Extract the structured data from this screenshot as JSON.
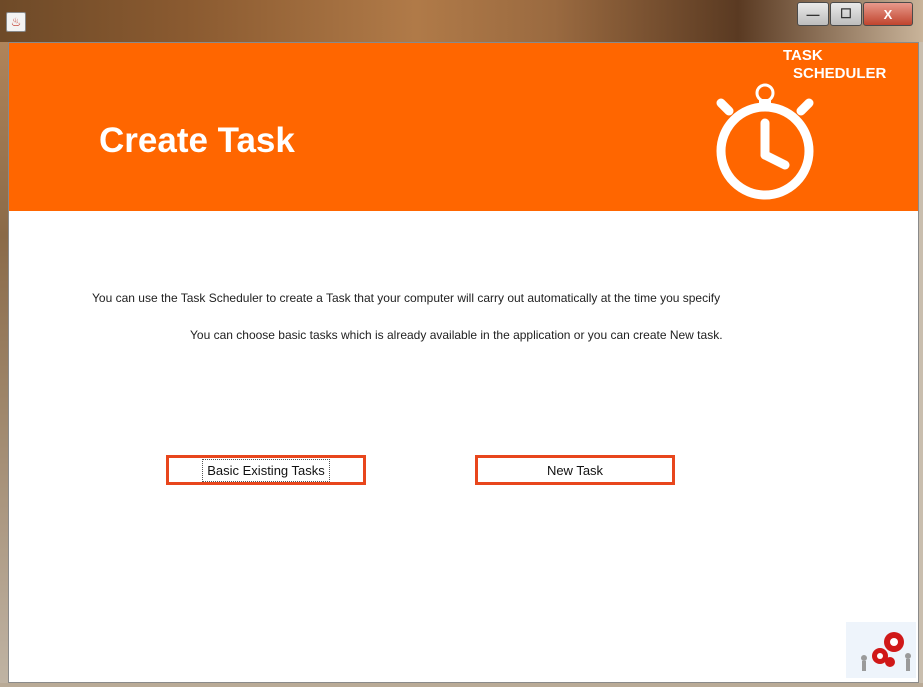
{
  "window": {
    "app_icon": "java-icon",
    "controls": {
      "minimize": "—",
      "maximize": "☐",
      "close": "X"
    }
  },
  "header": {
    "title": "Create Task",
    "brand_line1": "TASK",
    "brand_line2": "SCHEDULER",
    "brand_icon": "stopwatch-icon",
    "background": "#ff6600"
  },
  "main": {
    "description_line1": "You can use the Task Scheduler to create a Task that your computer will carry out automatically at the time you specify",
    "description_line2": "You can choose basic tasks which is already available in the application or you can create New task.",
    "buttons": {
      "basic_existing": "Basic Existing Tasks",
      "new_task": "New Task"
    },
    "button_border_color": "#e8461c"
  },
  "footer": {
    "logo": "gears-people-icon"
  }
}
